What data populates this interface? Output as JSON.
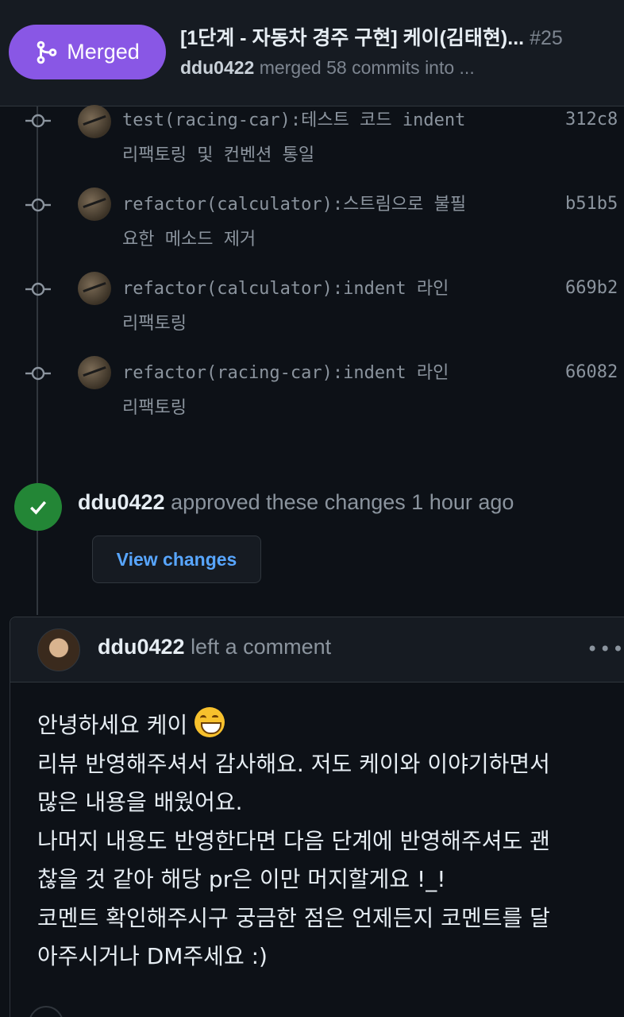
{
  "header": {
    "status_label": "Merged",
    "title": "[1단계 - 자동차 경주 구현] 케이(김태현)...",
    "number": "#25",
    "author": "ddu0422",
    "merge_text": "merged 58 commits into ..."
  },
  "commits": [
    {
      "message": "test(racing-car):테스트 코드 indent\n리팩토링 및 컨벤션 통일",
      "sha": "312c8"
    },
    {
      "message": "refactor(calculator):스트림으로 불필\n요한 메소드 제거",
      "sha": "b51b5"
    },
    {
      "message": "refactor(calculator):indent 라인\n리팩토링",
      "sha": "669b2"
    },
    {
      "message": "refactor(racing-car):indent 라인\n리팩토링",
      "sha": "66082"
    }
  ],
  "approval": {
    "author": "ddu0422",
    "text": "approved these changes 1 hour ago",
    "view_changes_label": "View changes"
  },
  "comment": {
    "author": "ddu0422",
    "action": "left a comment",
    "more_label": "•••",
    "lines": [
      "안녕하세요 케이",
      "리뷰 반영해주셔서 감사해요. 저도 케이와 이야기하면서",
      "많은 내용을 배웠어요.",
      "나머지 내용도 반영한다면 다음 단계에 반영해주셔도 괜",
      "찮을 것 같아 해당 pr은 이만 머지할게요 !_!",
      "코멘트 확인해주시구 궁금한 점은 언제든지 코멘트를 달",
      "아주시거나 DM주세요 :)"
    ],
    "emoji": "grinning-face-emoji"
  },
  "colors": {
    "merged": "#8957e5",
    "approved": "#238636",
    "link": "#58a6ff",
    "background": "#0d1117"
  }
}
